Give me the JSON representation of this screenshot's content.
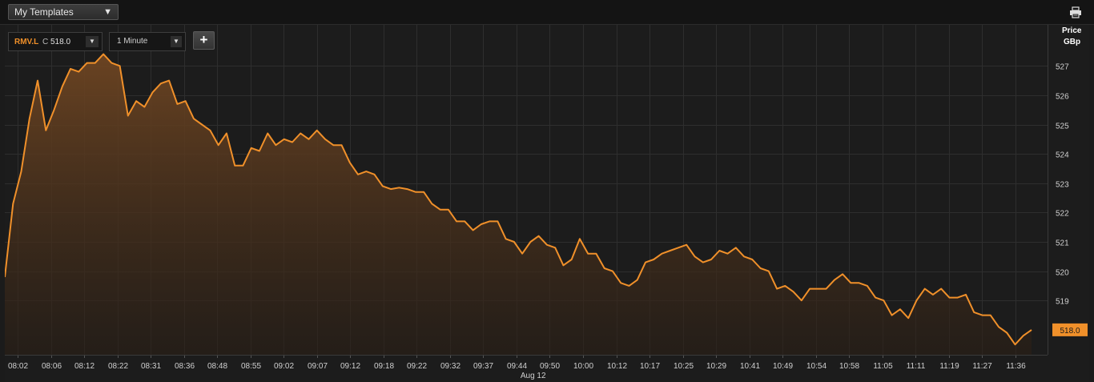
{
  "toolbar": {
    "template_select": "My Templates",
    "dropdown_glyph": "▼",
    "print_icon": "printer-icon"
  },
  "instrument": {
    "ric": "RMV.L",
    "close_label": "C",
    "close_value": "518.0",
    "interval": "1 Minute",
    "add_label": "+"
  },
  "colors": {
    "background": "#1c1c1c",
    "grid": "#2e2e2e",
    "line": "#f0902a",
    "price_tag": "#f0902a"
  },
  "chart_data": {
    "type": "area",
    "ylabel": "Price",
    "yunit": "GBp",
    "date_label": "Aug 12",
    "current_value_label": "518.0",
    "ylim": [
      517.15,
      528.4
    ],
    "yticks": [
      "519",
      "520",
      "521",
      "522",
      "523",
      "524",
      "525",
      "526",
      "527"
    ],
    "xticks": [
      "08:02",
      "08:06",
      "08:12",
      "08:22",
      "08:31",
      "08:36",
      "08:48",
      "08:55",
      "09:02",
      "09:07",
      "09:12",
      "09:18",
      "09:22",
      "09:32",
      "09:37",
      "09:44",
      "09:50",
      "10:00",
      "10:12",
      "10:17",
      "10:25",
      "10:29",
      "10:41",
      "10:49",
      "10:54",
      "10:58",
      "11:05",
      "11:11",
      "11:19",
      "11:27",
      "11:36"
    ],
    "grid": true,
    "series": [
      {
        "values": [
          519.8,
          522.3,
          523.4,
          525.2,
          526.5,
          524.8,
          525.5,
          526.3,
          526.9,
          526.8,
          527.1,
          527.1,
          527.4,
          527.1,
          527.0,
          525.3,
          525.8,
          525.6,
          526.1,
          526.4,
          526.5,
          525.7,
          525.8,
          525.2,
          525.0,
          524.8,
          524.3,
          524.7,
          523.6,
          523.6,
          524.2,
          524.1,
          524.7,
          524.3,
          524.5,
          524.4,
          524.7,
          524.5,
          524.8,
          524.5,
          524.3,
          524.3,
          523.7,
          523.3,
          523.4,
          523.3,
          522.9,
          522.8,
          522.85,
          522.8,
          522.7,
          522.7,
          522.3,
          522.1,
          522.1,
          521.7,
          521.7,
          521.4,
          521.6,
          521.7,
          521.7,
          521.1,
          521.0,
          520.6,
          521.0,
          521.2,
          520.9,
          520.8,
          520.2,
          520.4,
          521.1,
          520.6,
          520.6,
          520.1,
          520.0,
          519.6,
          519.5,
          519.7,
          520.3,
          520.4,
          520.6,
          520.7,
          520.8,
          520.9,
          520.5,
          520.3,
          520.4,
          520.7,
          520.6,
          520.8,
          520.5,
          520.4,
          520.1,
          520.0,
          519.4,
          519.5,
          519.3,
          519.0,
          519.4,
          519.4,
          519.4,
          519.7,
          519.9,
          519.6,
          519.6,
          519.5,
          519.1,
          519.0,
          518.5,
          518.7,
          518.4,
          519.0,
          519.4,
          519.2,
          519.4,
          519.1,
          519.1,
          519.2,
          518.6,
          518.5,
          518.5,
          518.1,
          517.9,
          517.5,
          517.8,
          518.0
        ]
      }
    ]
  }
}
